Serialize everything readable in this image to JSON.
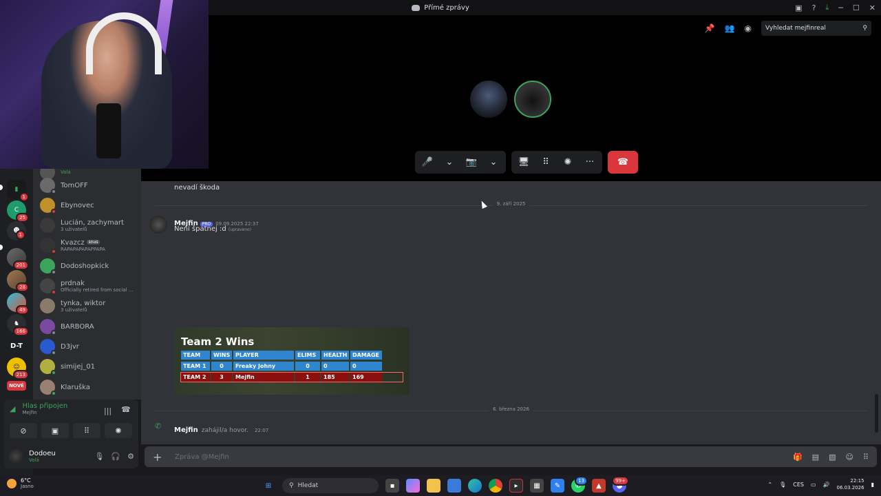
{
  "window": {
    "title": "Přímé zprávy",
    "controls": [
      "─",
      "☐",
      "✕"
    ]
  },
  "call": {
    "search_placeholder": "Vyhledat mejfinreal",
    "controls": {
      "mic": "🎤",
      "camera": "📷",
      "screen": "🖥",
      "activities": "⠿",
      "soundboard": "✺",
      "more": "···",
      "end": "☎"
    }
  },
  "servers": [
    {
      "badge": "1"
    },
    {
      "badge": "25"
    },
    {
      "badge": ""
    },
    {
      "badge": "1"
    },
    {
      "badge": "201"
    },
    {
      "badge": "28"
    },
    {
      "badge": "49"
    },
    {
      "badge": "166"
    },
    {
      "label": "D-T"
    },
    {
      "badge": "213"
    },
    {
      "label": "NOVÉ"
    }
  ],
  "dms": [
    {
      "name": "Volá",
      "sub": ""
    },
    {
      "name": "TomOFF",
      "sub": ""
    },
    {
      "name": "Ebynovec",
      "sub": ""
    },
    {
      "name": "Lucián, zachymart",
      "sub": "3 uživatelů"
    },
    {
      "name": "Kvazcz",
      "tag": "snus",
      "sub": "RAPAPAPAPAPPAPA"
    },
    {
      "name": "Dodoshopkick",
      "sub": ""
    },
    {
      "name": "prdnak",
      "sub": "Officially retired from social ..."
    },
    {
      "name": "tynka, wiktor",
      "sub": "3 uživatelů"
    },
    {
      "name": "BARBORA",
      "sub": ""
    },
    {
      "name": "D3jvr",
      "sub": ""
    },
    {
      "name": "simijej_01",
      "sub": ""
    },
    {
      "name": "Klaruška",
      "sub": ""
    }
  ],
  "voice": {
    "title": "Hlas připojen",
    "sub": "Mejfin"
  },
  "user": {
    "name": "Dodoeu",
    "status": "Volá"
  },
  "chat": {
    "prev_message": "nevadí škoda",
    "date1": "9. září 2025",
    "msg": {
      "author": "Mejfin",
      "badge": "PRO",
      "time": "09.09.2025 22:37",
      "text": "Není špatnej :d",
      "edited": "(upraveno)"
    },
    "scorecard": {
      "title": "Team 2 Wins",
      "headers": [
        "TEAM",
        "WINS",
        "PLAYER",
        "ELIMS",
        "HEALTH",
        "DAMAGE"
      ],
      "rows": [
        [
          "TEAM 1",
          "0",
          "Freaky Johny",
          "0",
          "0",
          "0"
        ],
        [
          "TEAM 2",
          "3",
          "Mejfin",
          "1",
          "185",
          "169"
        ]
      ]
    },
    "date2": "6. března 2026",
    "call_event": {
      "author": "Mejfin",
      "text": "zahájil/a hovor.",
      "time": "22:07"
    }
  },
  "input": {
    "placeholder": "Zpráva @Mejfin"
  },
  "taskbar": {
    "temp": "6°C",
    "weather": "Jasno",
    "search": "Hledat",
    "lang": "CES",
    "time": "22:15",
    "date": "06.03.2026",
    "badges": {
      "whatsapp": "13",
      "discord": "99+"
    }
  },
  "colors": {
    "accent": "#5865f2",
    "online": "#3ba55c",
    "danger": "#da373c",
    "bg": "#313338"
  }
}
